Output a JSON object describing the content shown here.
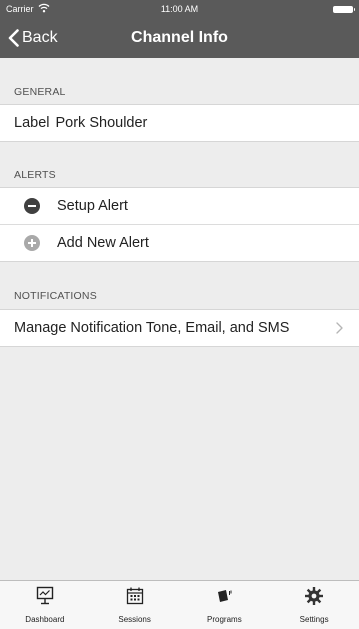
{
  "status_bar": {
    "carrier": "Carrier",
    "time": "11:00 AM"
  },
  "nav": {
    "back_label": "Back",
    "title": "Channel Info"
  },
  "sections": {
    "general": {
      "header": "GENERAL",
      "label": "Label",
      "value": "Pork Shoulder"
    },
    "alerts": {
      "header": "ALERTS",
      "items": [
        {
          "label": "Setup Alert",
          "icon": "remove-circle-icon"
        },
        {
          "label": "Add New Alert",
          "icon": "add-circle-icon"
        }
      ]
    },
    "notifications": {
      "header": "NOTIFICATIONS",
      "manage_label": "Manage Notification Tone, Email, and SMS"
    }
  },
  "tabbar": {
    "tabs": [
      {
        "label": "Dashboard",
        "icon": "dashboard-icon"
      },
      {
        "label": "Sessions",
        "icon": "calendar-icon"
      },
      {
        "label": "Programs",
        "icon": "programs-icon"
      },
      {
        "label": "Settings",
        "icon": "gear-icon"
      }
    ]
  },
  "colors": {
    "nav_bg": "#5a5a5a",
    "background": "#ededed",
    "cell_bg": "#ffffff",
    "remove_icon": "#404040",
    "add_icon": "#a9a9a9"
  }
}
